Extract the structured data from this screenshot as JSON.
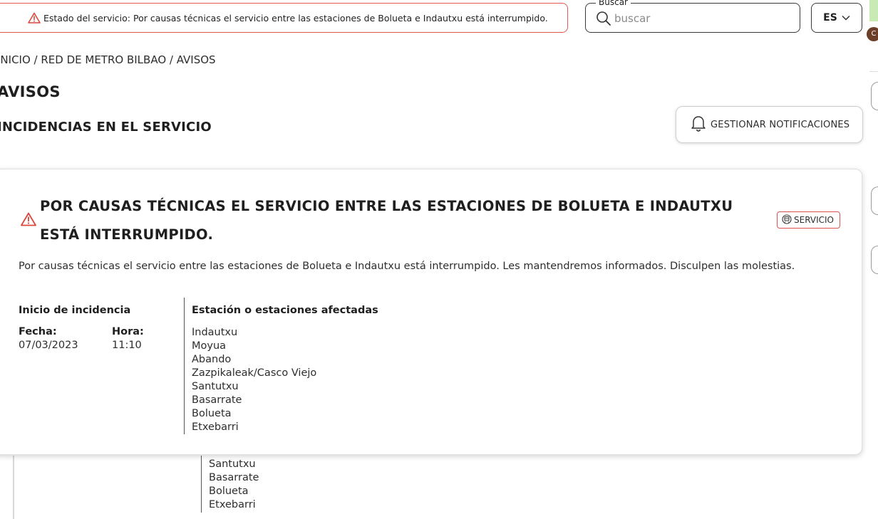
{
  "banner": {
    "text": "Estado del servicio: Por causas técnicas el servicio entre las estaciones de Bolueta e Indautxu está interrumpido."
  },
  "search": {
    "legend": "Buscar",
    "placeholder": "buscar"
  },
  "language": {
    "selected": "ES"
  },
  "breadcrumb": "INICIO / RED DE METRO BILBAO / AVISOS",
  "page_title": "AVISOS",
  "section_title": "INCIDENCIAS EN EL SERVICIO",
  "notifications_button": "GESTIONAR NOTIFICACIONES",
  "incident": {
    "title": "POR CAUSAS TÉCNICAS EL SERVICIO ENTRE LAS ESTACIONES DE BOLUETA E INDAUTXU ESTÁ INTERRUMPIDO.",
    "tag": "SERVICIO",
    "description": "Por causas técnicas el servicio entre las estaciones de Bolueta e Indautxu está interrumpido. Les mantendremos informados. Disculpen las molestias.",
    "start_heading": "Inicio de incidencia",
    "date_label": "Fecha:",
    "date_value": "07/03/2023",
    "time_label": "Hora:",
    "time_value": "11:10",
    "stations_heading": "Estación o estaciones afectadas",
    "stations": [
      "Indautxu",
      "Moyua",
      "Abando",
      "Zazpikaleak/Casco Viejo",
      "Santutxu",
      "Basarrate",
      "Bolueta",
      "Etxebarri"
    ]
  },
  "behind_stations": [
    "Santutxu",
    "Basarrate",
    "Bolueta",
    "Etxebarri"
  ],
  "colors": {
    "alert_red": "#e05a4f",
    "text": "#1f1f1f"
  }
}
